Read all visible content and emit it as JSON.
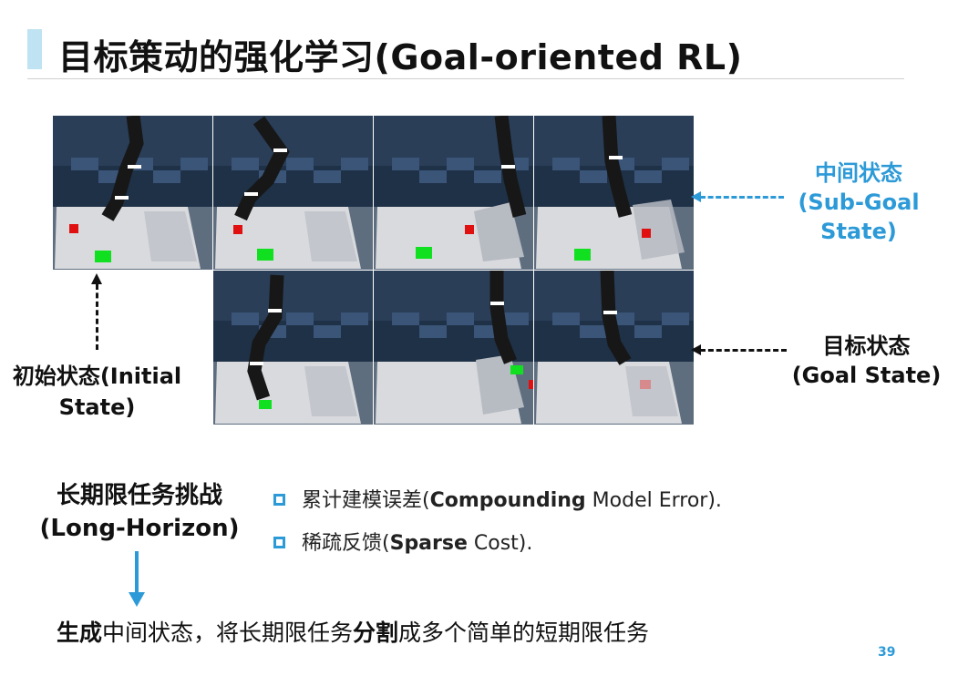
{
  "title": "目标策动的强化学习(Goal-oriented RL)",
  "labels": {
    "sub_goal_cn": "中间状态",
    "sub_goal_en_1": "(Sub-Goal",
    "sub_goal_en_2": "State)",
    "goal_cn": "目标状态",
    "goal_en": "(Goal State)",
    "initial_1": "初始状态(Initial",
    "initial_2": "State)"
  },
  "long_horizon": {
    "cn": "长期限任务挑战",
    "en": "(Long-Horizon)"
  },
  "bullets": [
    {
      "prefix": "累计建模误差(",
      "bold": "Compounding",
      "suffix": " Model Error)."
    },
    {
      "prefix": "稀疏反馈(",
      "bold": "Sparse",
      "suffix": " Cost)."
    }
  ],
  "summary": {
    "b1": "生成",
    "t1": "中间状态，将长期限任务",
    "b2": "分割",
    "t2": "成多个简单的短期限任务"
  },
  "page_number": "39",
  "colors": {
    "accent": "#2d9ad8",
    "title_bar": "#bfe3f3",
    "text": "#111111"
  },
  "frames": [
    {
      "row": 0,
      "col": 0,
      "caption": "initial"
    },
    {
      "row": 0,
      "col": 1,
      "caption": "sub-goal"
    },
    {
      "row": 0,
      "col": 2,
      "caption": "sub-goal"
    },
    {
      "row": 0,
      "col": 3,
      "caption": "sub-goal"
    },
    {
      "row": 1,
      "col": 1,
      "caption": "goal"
    },
    {
      "row": 1,
      "col": 2,
      "caption": "goal"
    },
    {
      "row": 1,
      "col": 3,
      "caption": "goal"
    }
  ]
}
